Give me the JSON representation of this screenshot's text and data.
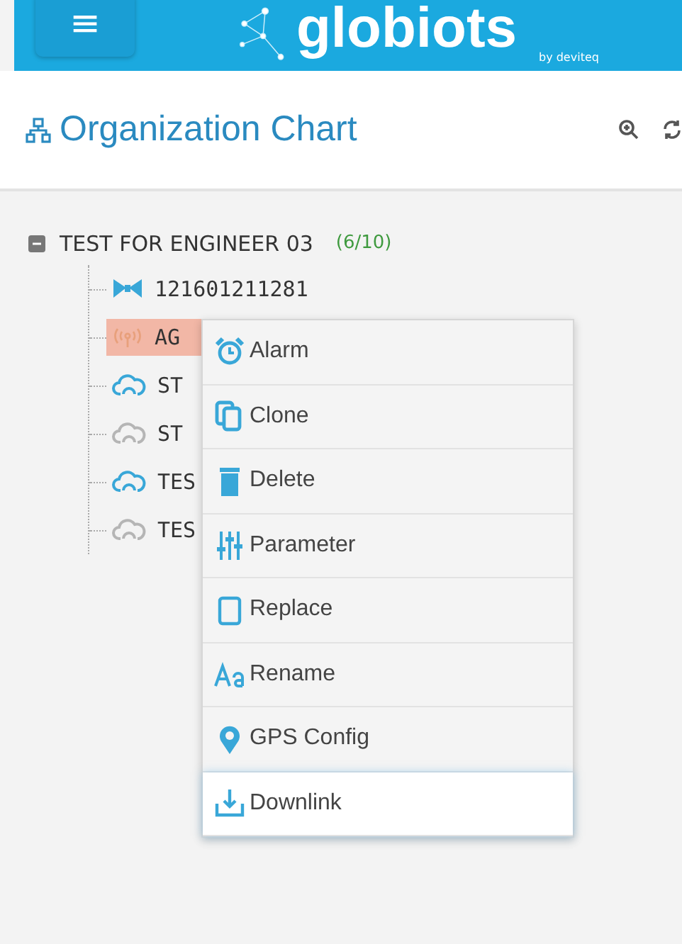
{
  "header": {
    "menu_button": "≡",
    "logo": "globiots",
    "logo_tagline": "by deviteq"
  },
  "title": "Organization Chart",
  "tree": {
    "label": "TEST FOR ENGINEER 03",
    "count": "(6/10)",
    "expanded": true,
    "children": [
      {
        "kind": "satellite",
        "label": "121601211281",
        "online": true,
        "selected": false
      },
      {
        "kind": "antenna",
        "label": "AG",
        "online": true,
        "selected": true
      },
      {
        "kind": "cloud",
        "label": "ST",
        "online": true,
        "selected": false
      },
      {
        "kind": "cloud",
        "label": "ST",
        "online": false,
        "selected": false
      },
      {
        "kind": "cloud",
        "label": "TES",
        "online": true,
        "selected": false
      },
      {
        "kind": "cloud",
        "label": "TES",
        "online": false,
        "selected": false
      }
    ]
  },
  "context_menu": [
    {
      "kind": "alarm",
      "label": "Alarm",
      "hovered": false
    },
    {
      "kind": "clone",
      "label": "Clone",
      "hovered": false
    },
    {
      "kind": "delete",
      "label": "Delete",
      "hovered": false
    },
    {
      "kind": "parameter",
      "label": "Parameter",
      "hovered": false
    },
    {
      "kind": "replace",
      "label": "Replace",
      "hovered": false
    },
    {
      "kind": "rename",
      "label": "Rename",
      "hovered": false
    },
    {
      "kind": "gps",
      "label": "GPS Config",
      "hovered": false
    },
    {
      "kind": "downlink",
      "label": "Downlink",
      "hovered": true
    }
  ]
}
